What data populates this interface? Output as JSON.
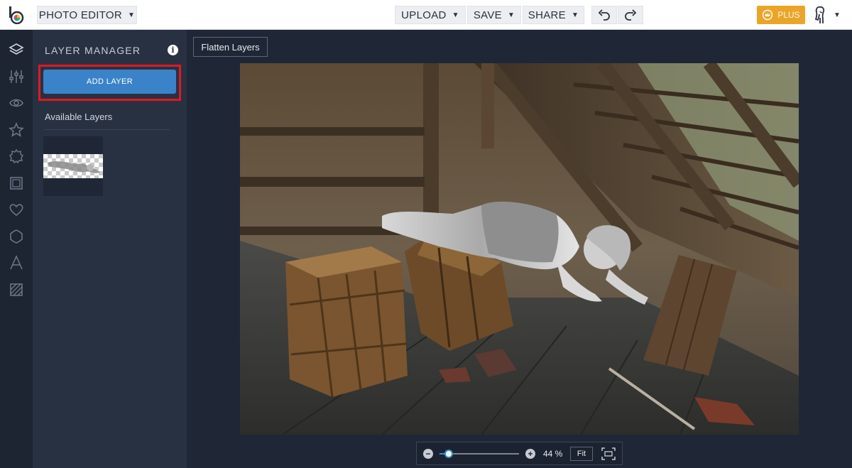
{
  "topbar": {
    "editor_label": "PHOTO EDITOR",
    "upload_label": "UPLOAD",
    "save_label": "SAVE",
    "share_label": "SHARE",
    "plus_label": "PLUS",
    "icons": {
      "logo": "befunky-logo-icon",
      "undo": "undo-icon",
      "redo": "redo-icon",
      "plus": "plus-crown-icon",
      "user": "user-avatar-icon",
      "caret": "caret-down-icon"
    }
  },
  "sidebar": {
    "items": [
      {
        "name": "layers",
        "icon": "layers-icon"
      },
      {
        "name": "edit",
        "icon": "sliders-icon"
      },
      {
        "name": "touch-up",
        "icon": "eye-icon"
      },
      {
        "name": "effects",
        "icon": "star-icon"
      },
      {
        "name": "artsy",
        "icon": "gear-badge-icon"
      },
      {
        "name": "frames",
        "icon": "frame-icon"
      },
      {
        "name": "overlays",
        "icon": "heart-icon"
      },
      {
        "name": "graphics",
        "icon": "badge-icon"
      },
      {
        "name": "text",
        "icon": "text-icon"
      },
      {
        "name": "textures",
        "icon": "texture-icon"
      }
    ]
  },
  "layer_manager": {
    "title": "LAYER MANAGER",
    "info_glyph": "i",
    "add_layer_label": "ADD LAYER",
    "available_label": "Available Layers"
  },
  "workspace": {
    "flatten_label": "Flatten Layers"
  },
  "zoom": {
    "minus_glyph": "−",
    "plus_glyph": "+",
    "value": "44 %",
    "level_fraction": 0.12,
    "fit_label": "Fit"
  },
  "colors": {
    "accent_blue": "#3b83c8",
    "plus_gold": "#eaa529",
    "highlight_red": "#e0191f",
    "panel_bg": "#283142",
    "workspace_bg": "#1f2736"
  }
}
